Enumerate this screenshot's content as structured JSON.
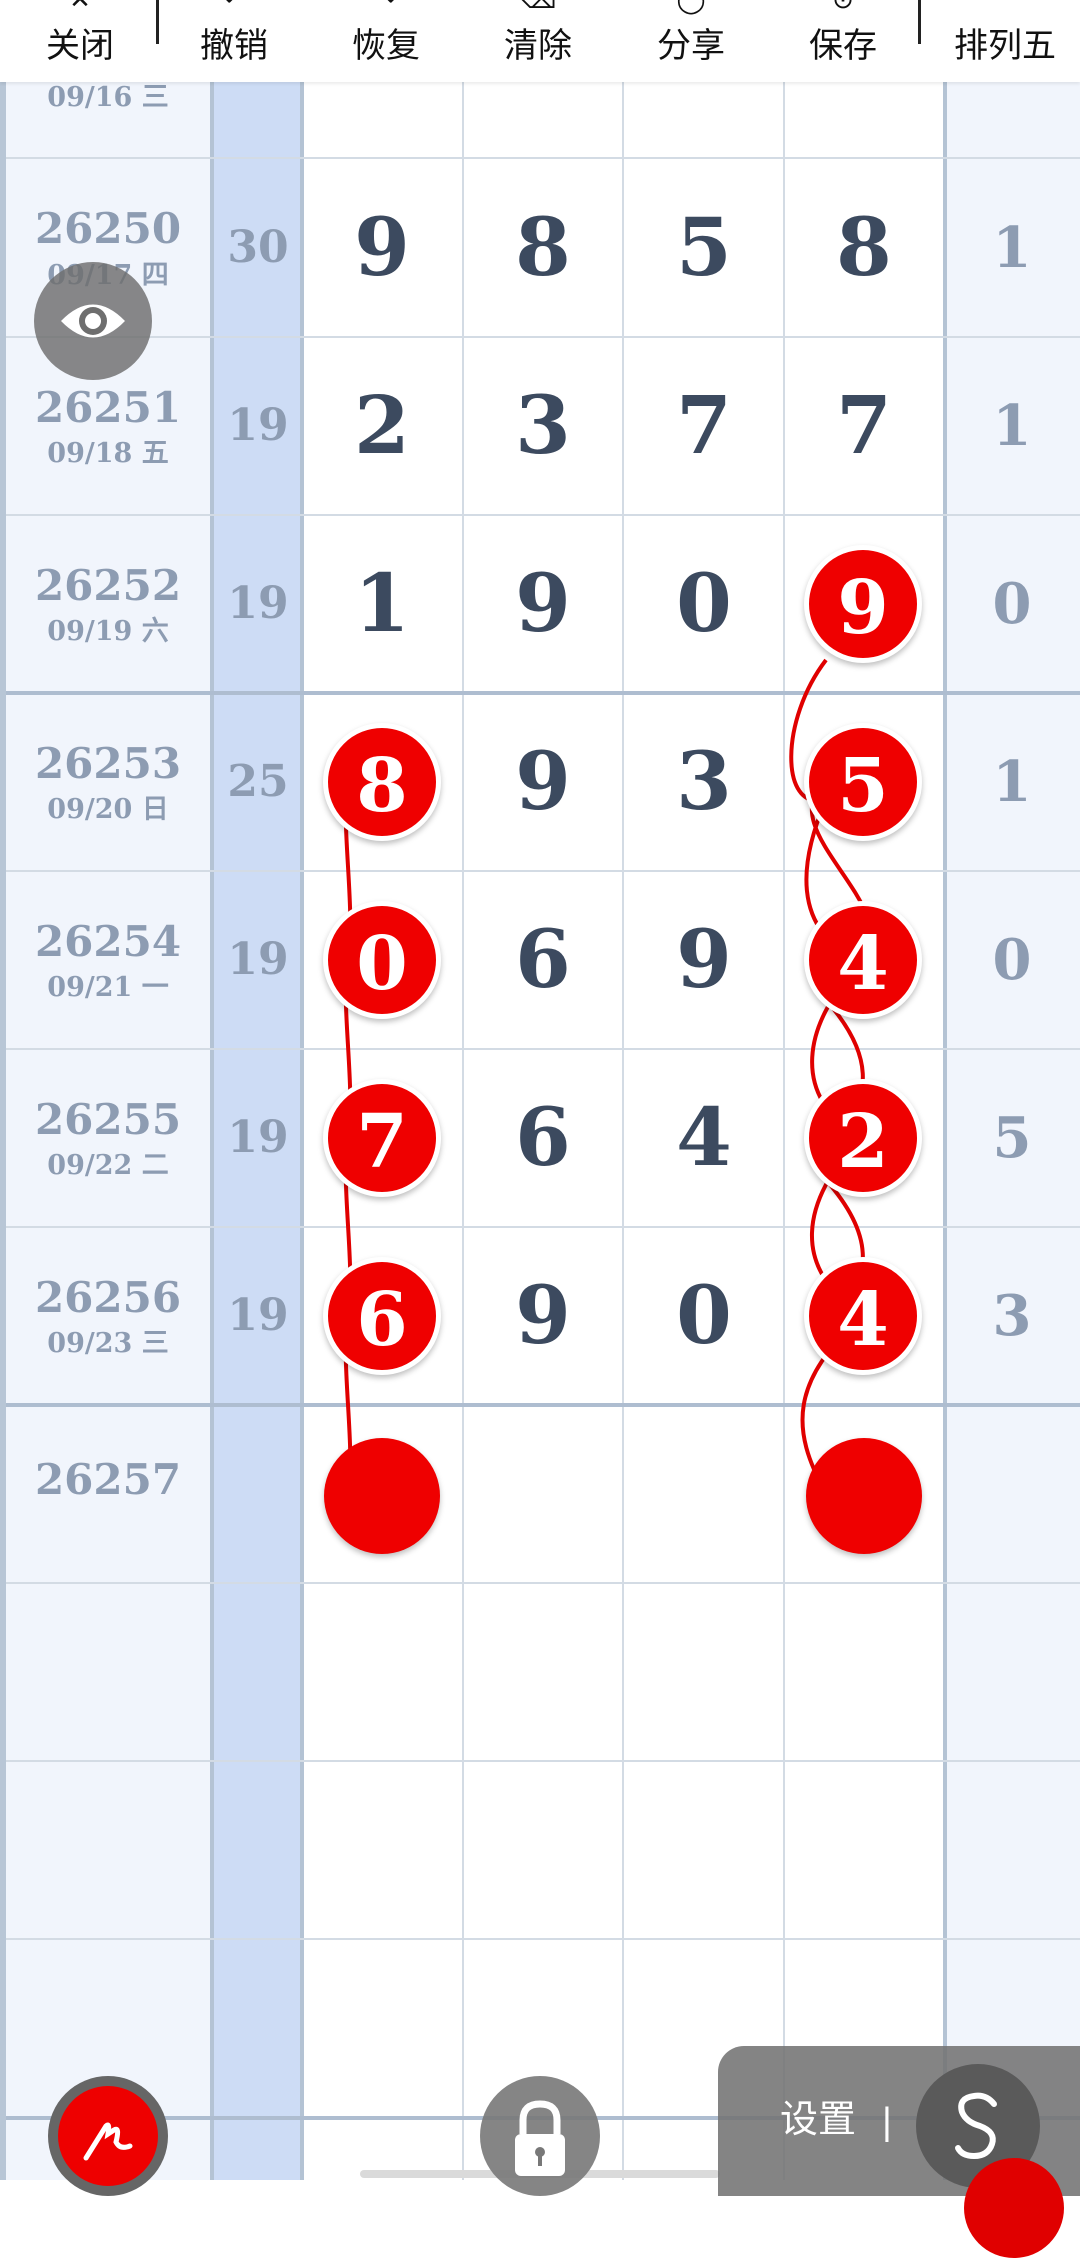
{
  "toolbar": {
    "buttons": [
      {
        "label": "关闭",
        "icon": "close-icon",
        "glyph": "✕"
      },
      {
        "label": "撤销",
        "icon": "undo-icon",
        "glyph": "↶"
      },
      {
        "label": "恢复",
        "icon": "redo-icon",
        "glyph": "↷"
      },
      {
        "label": "清除",
        "icon": "clear-icon",
        "glyph": "⌫"
      },
      {
        "label": "分享",
        "icon": "share-icon",
        "glyph": "◯"
      },
      {
        "label": "保存",
        "icon": "save-icon",
        "glyph": "⊙"
      }
    ],
    "lottery_name": "排列五"
  },
  "rows": [
    {
      "issue": "",
      "date": "09/16 三",
      "sum": "",
      "digits": [
        "",
        "",
        "",
        ""
      ],
      "last": "",
      "partial": true
    },
    {
      "issue": "26250",
      "date": "09/17 四",
      "sum": "30",
      "digits": [
        "9",
        "8",
        "5",
        "8"
      ],
      "last": "1"
    },
    {
      "issue": "26251",
      "date": "09/18 五",
      "sum": "19",
      "digits": [
        "2",
        "3",
        "7",
        "7"
      ],
      "last": "1"
    },
    {
      "issue": "26252",
      "date": "09/19 六",
      "sum": "19",
      "digits": [
        "1",
        "9",
        "0",
        "9"
      ],
      "last": "0"
    },
    {
      "issue": "26253",
      "date": "09/20 日",
      "sum": "25",
      "digits": [
        "8",
        "9",
        "3",
        "5"
      ],
      "last": "1"
    },
    {
      "issue": "26254",
      "date": "09/21 一",
      "sum": "19",
      "digits": [
        "0",
        "6",
        "9",
        "4"
      ],
      "last": "0"
    },
    {
      "issue": "26255",
      "date": "09/22 二",
      "sum": "19",
      "digits": [
        "7",
        "6",
        "4",
        "2"
      ],
      "last": "5"
    },
    {
      "issue": "26256",
      "date": "09/23 三",
      "sum": "19",
      "digits": [
        "6",
        "9",
        "0",
        "4"
      ],
      "last": "3"
    },
    {
      "issue": "26257",
      "date": "",
      "sum": "",
      "digits": [
        "",
        "",
        "",
        ""
      ],
      "last": ""
    }
  ],
  "marks": {
    "column1": [
      {
        "row": 4,
        "value": "8"
      },
      {
        "row": 5,
        "value": "0"
      },
      {
        "row": 6,
        "value": "7"
      },
      {
        "row": 7,
        "value": "6"
      },
      {
        "row": 8,
        "value": ""
      }
    ],
    "column4": [
      {
        "row": 3,
        "value": "9"
      },
      {
        "row": 4,
        "value": "5"
      },
      {
        "row": 5,
        "value": "4"
      },
      {
        "row": 6,
        "value": "2"
      },
      {
        "row": 7,
        "value": "4"
      },
      {
        "row": 8,
        "value": ""
      }
    ]
  },
  "colors": {
    "mark_red": "#ef0000",
    "sum_column_bg": "#cddcf5",
    "side_column_bg": "#f1f5fc",
    "digit_text": "#3c4a5f",
    "muted_text": "#8d9cb2"
  },
  "widgets": {
    "eye_icon": "eye-icon",
    "pen_icon": "pen-icon",
    "lock_icon": "lock-icon",
    "settings_label": "设置",
    "settings_separator": "|",
    "s_icon": "s-icon"
  }
}
